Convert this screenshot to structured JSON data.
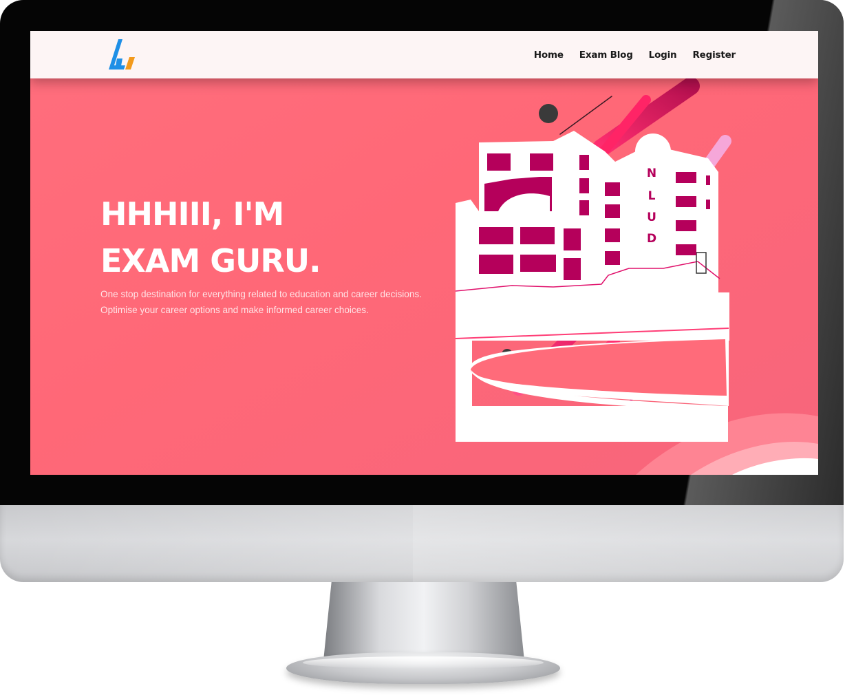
{
  "nav": {
    "logo_icon": "brand-logo-icon",
    "links": [
      "Home",
      "Exam Blog",
      "Login",
      "Register"
    ]
  },
  "hero": {
    "title": "HHHIII, I'M EXAM GURU.",
    "subtitle": "One stop destination for everything related to education and career decisions. Optimise your career options and make informed career choices."
  },
  "illustration": {
    "building_sign": [
      "N",
      "L",
      "U",
      "D"
    ]
  },
  "colors": {
    "hero_background": "#ff6b7a",
    "navbar_background": "#fdf5f5",
    "accent_magenta": "#e0106b",
    "window_color": "#b5005b",
    "logo_blue": "#1e8fe6",
    "logo_orange": "#f39a1c"
  }
}
